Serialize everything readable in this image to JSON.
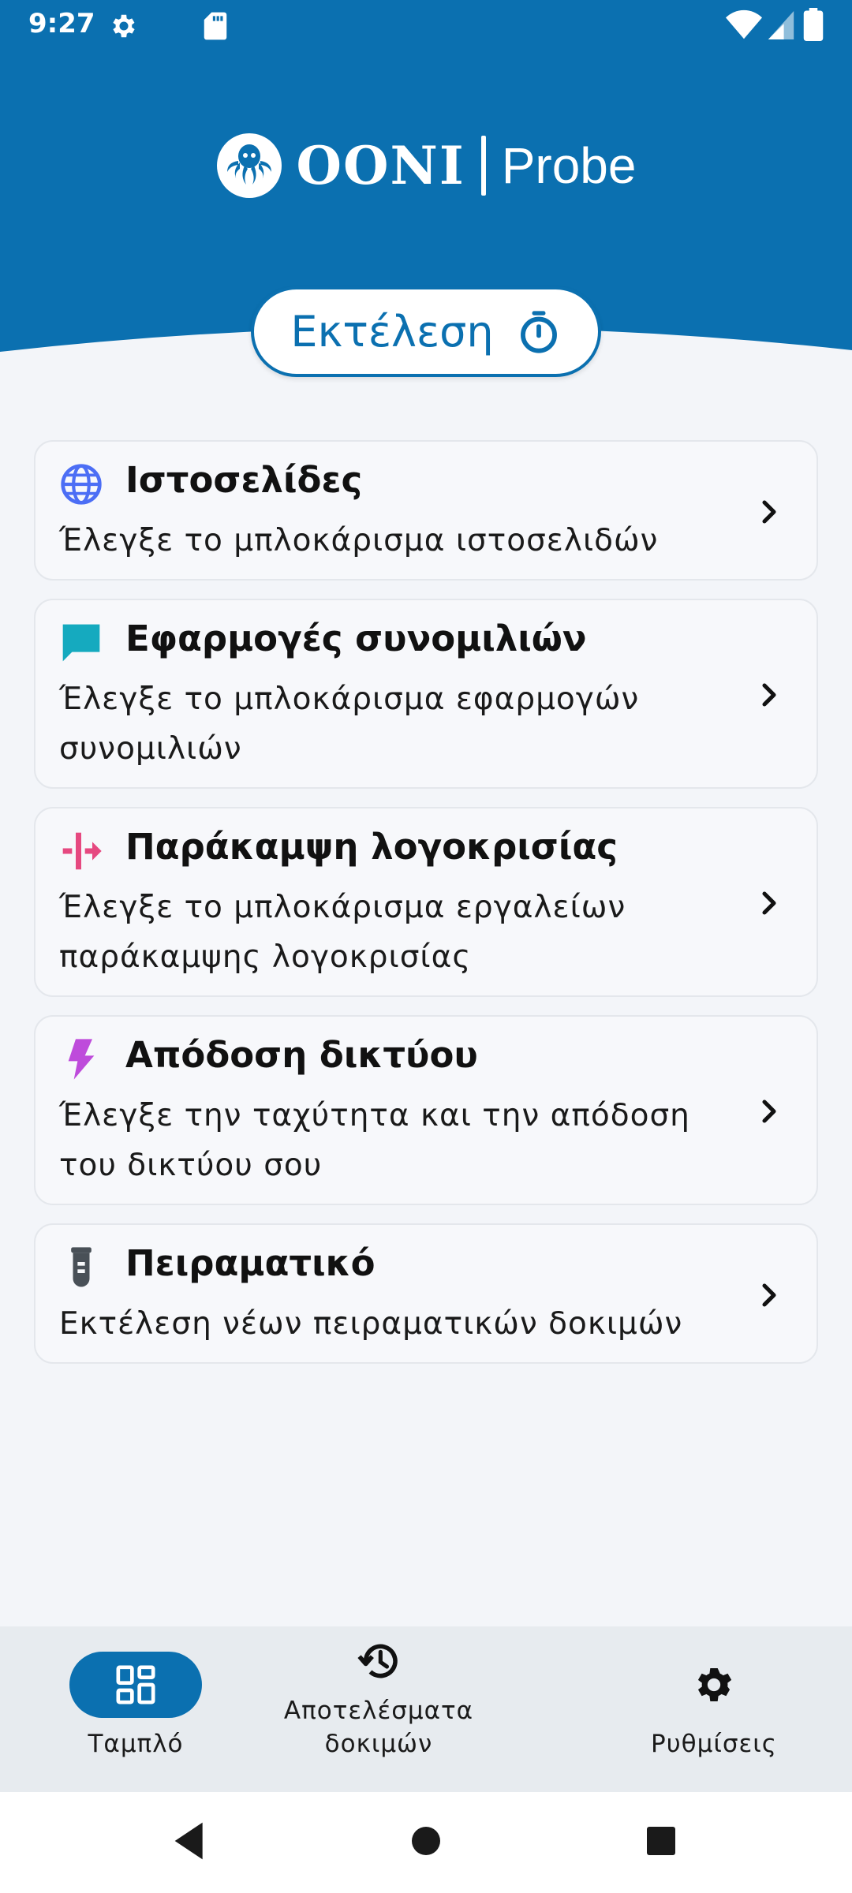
{
  "status_bar": {
    "time": "9:27",
    "icons": [
      "settings-icon",
      "sd-card-icon",
      "wifi-icon",
      "signal-icon",
      "battery-icon"
    ]
  },
  "brand": {
    "logo_icon": "ooni-octopus-logo",
    "name": "OONI",
    "product": "Probe"
  },
  "run_button": {
    "label": "Εκτέλεση",
    "icon": "timer-icon"
  },
  "test_cards": [
    {
      "id": "websites",
      "icon": "globe-icon",
      "icon_color": "#4c6ef5",
      "title": "Ιστοσελίδες",
      "description": "Έλεγξε το μπλοκάρισμα ιστοσελιδών"
    },
    {
      "id": "instant-messaging",
      "icon": "chat-bubble-icon",
      "icon_color": "#15aabf",
      "title": "Εφαρμογές συνομιλιών",
      "description": "Έλεγξε το μπλοκάρισμα εφαρμογών συνομιλιών"
    },
    {
      "id": "circumvention",
      "icon": "bypass-icon",
      "icon_color": "#e64980",
      "title": "Παράκαμψη λογοκρισίας",
      "description": "Έλεγξε το μπλοκάρισμα εργαλείων παράκαμψης λογοκρισίας"
    },
    {
      "id": "performance",
      "icon": "lightning-icon",
      "icon_color": "#be4bdb",
      "title": "Απόδοση δικτύου",
      "description": "Έλεγξε την ταχύτητα και την απόδοση του δικτύου σου"
    },
    {
      "id": "experimental",
      "icon": "test-tube-icon",
      "icon_color": "#495057",
      "title": "Πειραματικό",
      "description": "Εκτέλεση νέων πειραματικών δοκιμών"
    }
  ],
  "bottom_nav": {
    "items": [
      {
        "id": "dashboard",
        "label": "Ταμπλό",
        "icon": "dashboard-icon",
        "selected": true
      },
      {
        "id": "results",
        "label": "Αποτελέσματα δοκιμών",
        "icon": "history-icon",
        "selected": false
      },
      {
        "id": "settings",
        "label": "Ρυθμίσεις",
        "icon": "gear-icon",
        "selected": false
      }
    ]
  },
  "system_nav": {
    "icons": [
      "back-icon",
      "home-icon",
      "recents-icon"
    ]
  },
  "colors": {
    "brand_blue": "#0b70b0",
    "background": "#f3f5f9",
    "nav_background": "#e7ebef"
  }
}
